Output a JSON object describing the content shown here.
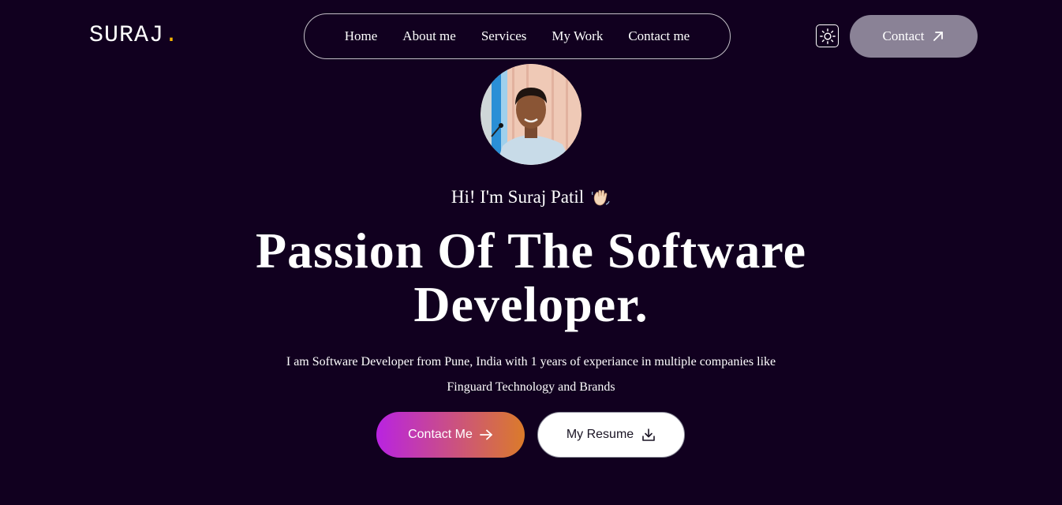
{
  "brand": {
    "name": "SURAJ",
    "dot": ".",
    "accent_color": "#f5b400"
  },
  "nav": {
    "items": [
      {
        "label": "Home"
      },
      {
        "label": "About me"
      },
      {
        "label": "Services"
      },
      {
        "label": "My Work"
      },
      {
        "label": "Contact me"
      }
    ]
  },
  "header": {
    "theme_toggle_icon": "sun-icon",
    "contact_label": "Contact",
    "contact_icon": "arrow-up-right-icon"
  },
  "hero": {
    "avatar_icon": "profile-photo",
    "greeting": "Hi! I'm Suraj Patil",
    "greeting_icon": "waving-hand-icon",
    "headline_line1": "Passion Of The Software",
    "headline_line2": "Developer.",
    "intro": "I am Software Developer from Pune, India with 1 years of experiance in multiple companies like Finguard Technology and Brands",
    "primary_button": {
      "label": "Contact Me",
      "icon": "arrow-right-icon"
    },
    "secondary_button": {
      "label": "My Resume",
      "icon": "download-icon"
    }
  },
  "colors": {
    "background": "#11001f",
    "gradient_start": "#b923e1",
    "gradient_end": "#db7b2a"
  }
}
